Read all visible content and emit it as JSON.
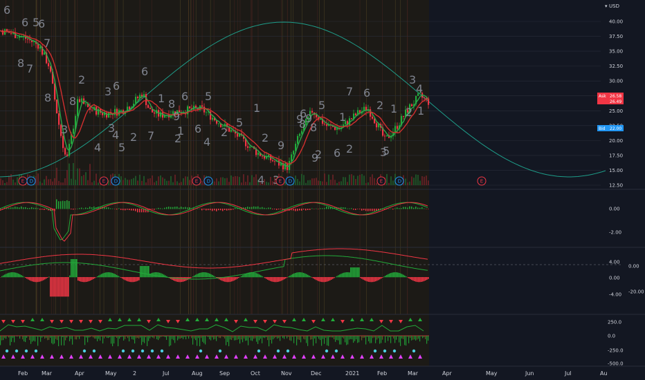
{
  "currency": "USD",
  "colors": {
    "background": "#131722",
    "up": "#22ab3a",
    "down": "#f23645",
    "ma_green": "#2aa84a",
    "ma_red": "#d32f2f",
    "curve": "#1e9e8a",
    "ask_badge": "#f23645",
    "bid_badge": "#2196f3",
    "earnings_event": "#f23645",
    "dividend_event": "#2196f3"
  },
  "price_axis": {
    "labels": [
      "40.00",
      "37.50",
      "35.00",
      "32.50",
      "30.00",
      "27.50",
      "25.00",
      "22.50",
      "20.00",
      "17.50",
      "15.00",
      "12.50"
    ],
    "ask_label": "Ask",
    "ask_value": "26.58",
    "last_value": "26.49",
    "bid_label": "Bid",
    "bid_value": "22.00"
  },
  "pane2_axis": {
    "labels": [
      "0.00",
      "-2.00"
    ]
  },
  "pane3_axis": {
    "labels": [
      "4.00",
      "0.00",
      "-4.00"
    ],
    "right_labels": [
      "0.00",
      "-20.00"
    ]
  },
  "pane4_axis": {
    "labels": [
      "250.0",
      "0.0",
      "-250.0",
      "-500.0"
    ]
  },
  "time_axis": [
    "Feb",
    "Mar",
    "Apr",
    "May",
    "2",
    "Jul",
    "Aug",
    "Sep",
    "Oct",
    "Nov",
    "Dec",
    "2021",
    "Feb",
    "Mar",
    "Apr",
    "May",
    "Jun",
    "Jul",
    "Au"
  ],
  "wave_counts": [
    "6",
    "6",
    "5",
    "6",
    "7",
    "8",
    "8",
    "7",
    "2",
    "4",
    "3",
    "8",
    "3",
    "4",
    "5",
    "3",
    "6",
    "2",
    "6",
    "7",
    "1",
    "9",
    "8",
    "2",
    "6",
    "1",
    "5",
    "6",
    "4",
    "2",
    "5",
    "1",
    "2",
    "4",
    "3",
    "9",
    "8",
    "9",
    "5",
    "6",
    "2",
    "1",
    "2",
    "6",
    "7",
    "2",
    "3",
    "5",
    "1",
    "1",
    "4",
    "3",
    "2",
    "9",
    "6",
    "9",
    "8"
  ],
  "events": [
    {
      "kind": "E",
      "label": "E"
    },
    {
      "kind": "D",
      "label": "D"
    },
    {
      "kind": "E",
      "label": "E"
    },
    {
      "kind": "D",
      "label": "D"
    },
    {
      "kind": "E",
      "label": "E"
    },
    {
      "kind": "D",
      "label": "D"
    },
    {
      "kind": "E",
      "label": "E"
    },
    {
      "kind": "D",
      "label": "D"
    },
    {
      "kind": "E",
      "label": "E"
    },
    {
      "kind": "D",
      "label": "D"
    },
    {
      "kind": "E",
      "label": "E"
    }
  ]
}
